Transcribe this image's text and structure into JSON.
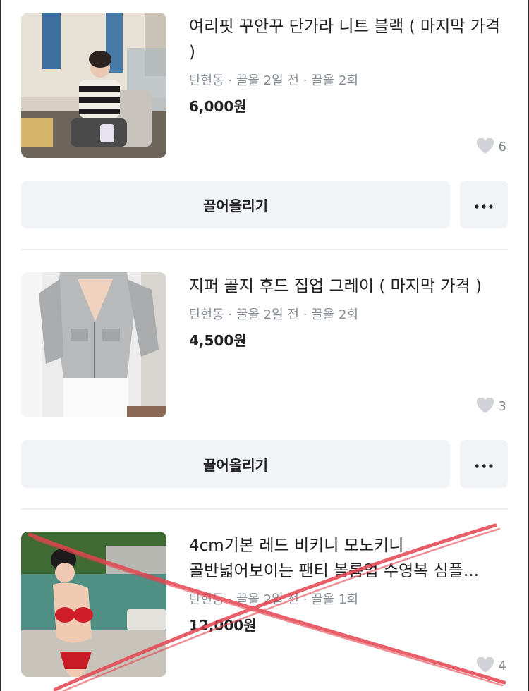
{
  "labels": {
    "bump": "끌어올리기"
  },
  "colors": {
    "accent_cross": "#e5434f",
    "meta_gray": "#868b94",
    "button_bg": "#f2f3f6"
  },
  "products": [
    {
      "title": "여리핏 꾸안꾸 단가라 니트 블랙 ( 마지막 가격 )",
      "meta": "탄현동 · 끌올 2일 전 · 끌올 2회",
      "price": "6,000원",
      "likes": "6",
      "image": "woman-striped-knit-photo"
    },
    {
      "title": "지퍼 골지 후드 집업 그레이 ( 마지막 가격 )",
      "meta": "탄현동 · 끌올 2일 전 · 끌올 2회",
      "price": "4,500원",
      "likes": "3",
      "image": "gray-hood-zipup-photo"
    },
    {
      "title": "4cm기본 레드 비키니 모노키니\n골반넓어보이는 팬티 볼륨업 수영복 심플...",
      "meta": "탄현동 · 끌올 2일 전 · 끌올 1회",
      "price": "12,000원",
      "likes": "4",
      "image": "red-bikini-poolside-photo",
      "crossed_out": true
    }
  ],
  "icons": {
    "like": "heart-icon",
    "more": "more-dots-icon"
  }
}
